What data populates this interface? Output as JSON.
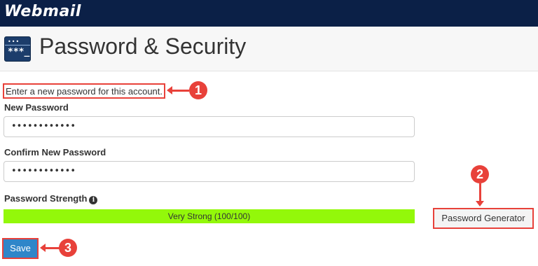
{
  "app": {
    "logo": "Webmail"
  },
  "page": {
    "title": "Password & Security",
    "icon_dots": "•••",
    "icon_stars": "***_",
    "icon": "password-terminal-icon"
  },
  "form": {
    "description": "Enter a new password for this account.",
    "new_password": {
      "label": "New Password",
      "value": "••••••••••••"
    },
    "confirm_password": {
      "label": "Confirm New Password",
      "value": "••••••••••••"
    },
    "strength": {
      "label": "Password Strength",
      "text": "Very Strong (100/100)",
      "score": 100,
      "info_icon": "info-icon",
      "bar_color": "#93f80a"
    },
    "generator_label": "Password Generator",
    "save_label": "Save"
  },
  "annotations": {
    "markers": [
      "1",
      "2",
      "3"
    ],
    "color": "#e8413a"
  },
  "colors": {
    "topbar": "#0b2047",
    "save_button": "#2f86c9"
  }
}
